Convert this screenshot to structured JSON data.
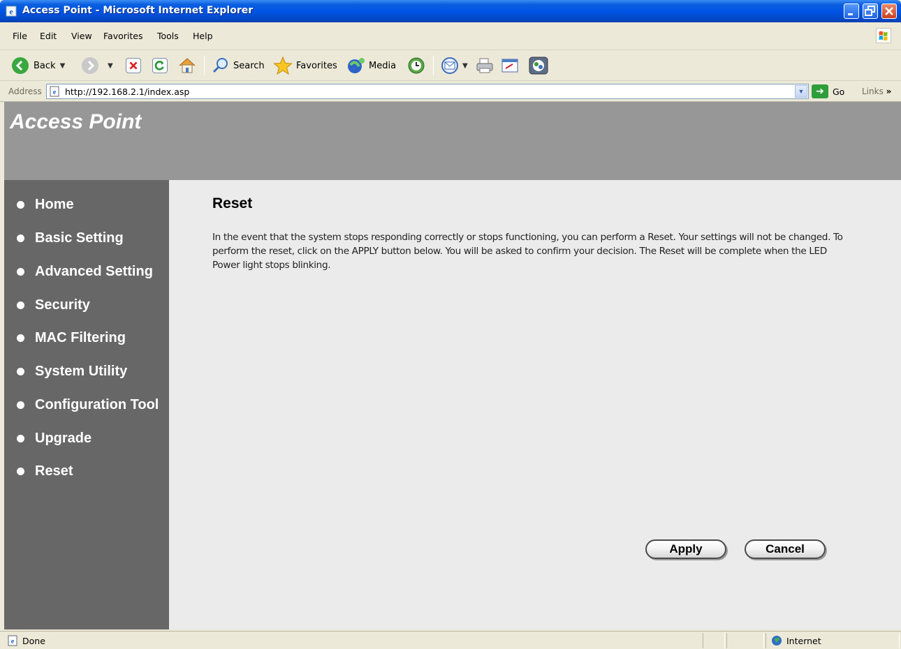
{
  "window": {
    "title": "Access Point - Microsoft Internet Explorer"
  },
  "menu": [
    "File",
    "Edit",
    "View",
    "Favorites",
    "Tools",
    "Help"
  ],
  "toolbar": {
    "back": "Back",
    "search": "Search",
    "favorites": "Favorites",
    "media": "Media"
  },
  "address": {
    "label": "Address",
    "url": "http://192.168.2.1/index.asp",
    "go": "Go",
    "links": "Links"
  },
  "header": {
    "brand": "Access Point"
  },
  "sidebar": {
    "items": [
      {
        "label": "Home"
      },
      {
        "label": "Basic Setting"
      },
      {
        "label": "Advanced Setting"
      },
      {
        "label": "Security"
      },
      {
        "label": "MAC Filtering"
      },
      {
        "label": "System Utility"
      },
      {
        "label": "Configuration Tool"
      },
      {
        "label": "Upgrade"
      },
      {
        "label": "Reset"
      }
    ]
  },
  "main": {
    "title": "Reset",
    "description": "In the event that the system stops responding correctly or stops functioning, you can perform a Reset. Your settings will not be changed. To perform the reset, click on the APPLY button below. You will be asked to confirm your decision. The Reset will be complete when the LED Power light stops blinking.",
    "apply_label": "Apply",
    "cancel_label": "Cancel"
  },
  "status": {
    "text": "Done",
    "zone": "Internet"
  },
  "colors": {
    "sidebar_bg": "#676767",
    "header_bg": "#979797",
    "content_bg": "#ebebeb",
    "titlebar_blue": "#0054e3"
  },
  "icons": [
    "ie-icon",
    "minimize-icon",
    "maximize-icon",
    "close-icon",
    "windows-logo-icon",
    "back-icon",
    "forward-icon",
    "stop-icon",
    "refresh-icon",
    "home-icon",
    "search-icon",
    "favorites-icon",
    "media-icon",
    "history-icon",
    "mail-icon",
    "print-icon",
    "edit-icon",
    "messenger-icon",
    "page-icon",
    "go-icon",
    "internet-zone-icon"
  ]
}
